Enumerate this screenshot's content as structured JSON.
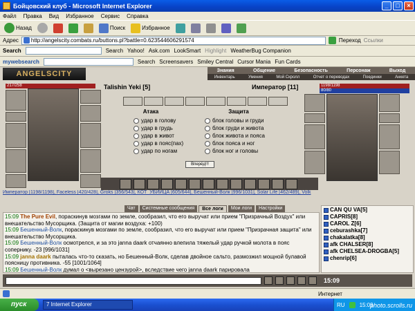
{
  "window": {
    "title": "Бойцовский клуб - Microsoft Internet Explorer"
  },
  "menu": [
    "Файл",
    "Правка",
    "Вид",
    "Избранное",
    "Сервис",
    "Справка"
  ],
  "toolbar": {
    "back": "Назад",
    "search": "Поиск",
    "favorites": "Избранное"
  },
  "address": {
    "label": "Адрес",
    "url": "http://angelscity.combats.ru/buttons.pl?battle=0.623544606291574",
    "go": "Переход",
    "links": "Ссылки"
  },
  "toolbar2": {
    "search_label": "Search",
    "search_btn": "Search",
    "yahoo": "Yahoo!",
    "ask": "Ask.com",
    "looksmart": "LookSmart",
    "highlight": "Highlight",
    "weather": "WeatherBug Companion"
  },
  "toolbar3": {
    "brand": "mywebsearch",
    "search_btn": "Search",
    "screensavers": "Screensavers",
    "smiley": "Smiley Central",
    "cursor": "Cursor Mania",
    "funcards": "Fun Cards"
  },
  "game": {
    "logo": "ANGELSCITY",
    "nav_top": [
      "Знания",
      "Общение",
      "Безопасность",
      "Персонаж",
      "Выход"
    ],
    "nav_bottom": [
      "Инвентарь",
      "Умения",
      "Мой Скролл",
      "Отчет о переводах",
      "Поединки",
      "Анкета"
    ],
    "left_player": {
      "hp": "217/258",
      "name": "Talishin Yeki [5]"
    },
    "right_player": {
      "hp": "1198/1198",
      "mana": "80/80",
      "name": "Император [11]"
    },
    "attack_title": "Атака",
    "defense_title": "Защита",
    "attack_options": [
      "удар в голову",
      "удар в грудь",
      "удар в живот",
      "удар в пояс(пах)",
      "удар по ногам"
    ],
    "defense_options": [
      "блок головы и груди",
      "блок груди и живота",
      "блок живота и пояса",
      "блок пояса и ног",
      "блок ног и головы"
    ],
    "attack_button": "Вперёд!!!",
    "fighters_line": "Император [1198/1198], Faceless [420/428], Groks [356/543], КОТ_УБИЙЦА [605/644], Бешенный-Волк [996/1031], Solar Life [462/489], Volk",
    "tabs": [
      "Чат",
      "Системные сообщения",
      "Все логи",
      "Мои логи",
      "Настройки"
    ],
    "log": [
      {
        "time": "15:09",
        "name": "The Pure Evil",
        "text": ", пораскинув мозгами по земле, сообразил, что его выручат или прием \"Призрачный Воздух\" или внешательство Мусорщика. (Защита от магии воздуха: +100)"
      },
      {
        "time": "15:09",
        "name": "Бешенный-Волк",
        "text": ", пораскинув мозгами по земле, сообразил, что его выручат или прием \"Призрачная защита\" или внешательство Мусорщика."
      },
      {
        "time": "15:09",
        "name": "Бешенный-Волк",
        "text": " осмотрелся, и за это janna daark отчаянно влепила тяжелый удар ручкой молота в пояс сопернику. -23 [996/1031]"
      },
      {
        "time": "15:09",
        "name": "janna daark",
        "text": " пыталась что-то сказать, но Бешенный-Волк, сделав двойное сальто, размозжил мощной булавой поясницу противника. -55 [1001/1064]"
      },
      {
        "time": "15:09",
        "name": "Бешенный-Волк",
        "text": " думал о <вырезано цензурой>, вследствие чего janna daark парировала"
      }
    ],
    "players": [
      {
        "name": "CAN QU VA[5]"
      },
      {
        "name": "CAPRIS[8]"
      },
      {
        "name": "CAROL Z[6]"
      },
      {
        "name": "ceburashka[7]"
      },
      {
        "name": "chakalatka[8]"
      },
      {
        "name": "afk CHALSER[8]"
      },
      {
        "name": "afk CHELSEA-DROGBA[5]"
      },
      {
        "name": "chenrip[6]"
      }
    ],
    "clock": "15:09"
  },
  "status": {
    "text": "Интернет"
  },
  "taskbar": {
    "start": "пуск",
    "item": "7 Internet Explorer",
    "lang": "RU",
    "time": "15:09"
  },
  "watermark": "photo.scrolls.ru"
}
